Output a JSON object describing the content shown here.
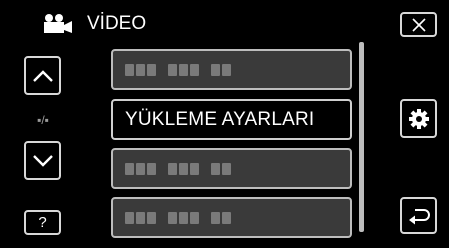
{
  "header": {
    "mode_icon": "movie-camera-icon",
    "title": "VİDEO",
    "close_icon": "close-icon"
  },
  "left_panel": {
    "up_icon": "chevron-up-icon",
    "page_indicator": "▪/▪",
    "down_icon": "chevron-down-icon",
    "help_label": "?"
  },
  "menu": {
    "items": [
      {
        "label": "",
        "state": "disabled"
      },
      {
        "label": "YÜKLEME AYARLARI",
        "state": "selected"
      },
      {
        "label": "",
        "state": "disabled"
      },
      {
        "label": "",
        "state": "disabled"
      }
    ]
  },
  "right_panel": {
    "settings_icon": "gear-icon",
    "back_icon": "return-icon"
  }
}
